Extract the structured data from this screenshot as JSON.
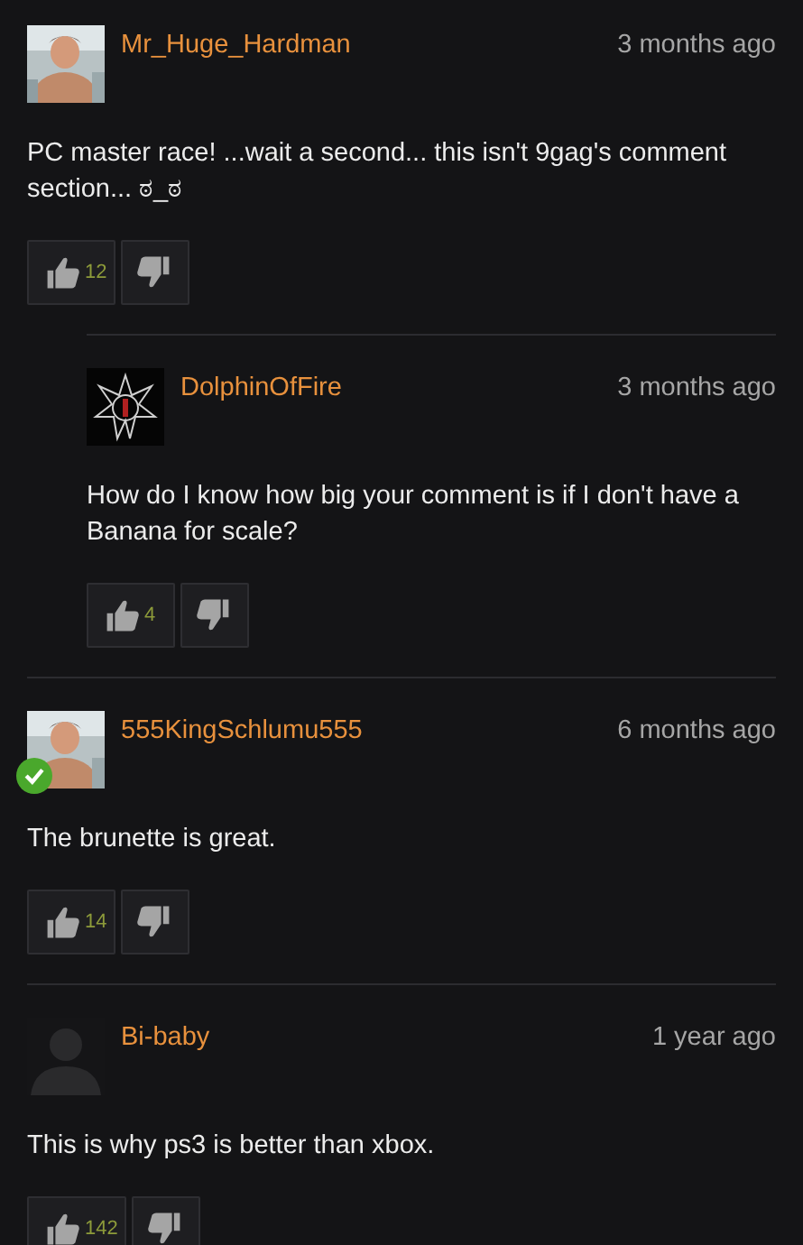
{
  "comments": [
    {
      "author": "Mr_Huge_Hardman",
      "verified": false,
      "time": "3 months ago",
      "text": "PC master race! ...wait a second... this isn't 9gag's comment section... ಠ_ಠ",
      "likes": "12",
      "children": [
        {
          "avatar": {
            "kind": "emblem"
          },
          "author": "DolphinOfFire",
          "verified": false,
          "time": "3 months ago",
          "text": "How do I know how big your comment is if I don't have a Banana for scale?",
          "likes": "4"
        }
      ]
    },
    {
      "author": "555KingSchlumu555",
      "verified": true,
      "time": "6 months ago",
      "text": "The brunette is great.",
      "likes": "14"
    },
    {
      "avatar": {
        "kind": "default"
      },
      "author": "Bi-baby",
      "verified": false,
      "time": "1 year ago",
      "text": "This is why ps3 is better than xbox.",
      "likes": "142"
    }
  ]
}
